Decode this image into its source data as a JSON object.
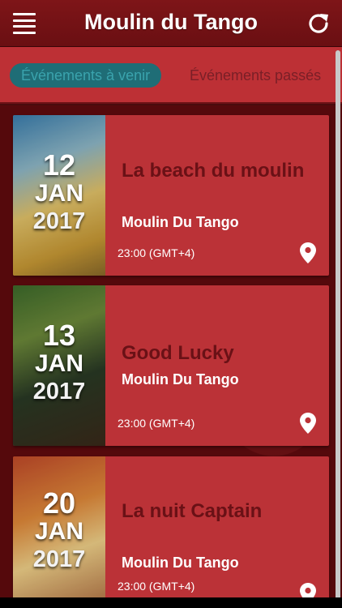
{
  "header": {
    "title": "Moulin du Tango",
    "menu_icon": "hamburger-menu-icon",
    "refresh_icon": "refresh-icon"
  },
  "tabs": [
    {
      "label": "Événements à venir",
      "active": true
    },
    {
      "label": "Événements passés",
      "active": false
    }
  ],
  "events": [
    {
      "day": "12",
      "month": "JAN",
      "year": "2017",
      "title": "La beach du moulin",
      "venue": "Moulin Du Tango",
      "time": "23:00 (GMT+4)"
    },
    {
      "day": "13",
      "month": "JAN",
      "year": "2017",
      "title": "Good Lucky",
      "venue": "Moulin Du Tango",
      "time": "23:00 (GMT+4)"
    },
    {
      "day": "20",
      "month": "JAN",
      "year": "2017",
      "title": "La nuit Captain",
      "venue": "Moulin Du Tango",
      "time": "23:00 (GMT+4)"
    }
  ],
  "colors": {
    "header_bg": "#7e1518",
    "tabs_bg": "#bd3035",
    "card_bg": "#bb3237",
    "title_color": "#6a1116",
    "active_tab_bg": "#1f6d76"
  }
}
